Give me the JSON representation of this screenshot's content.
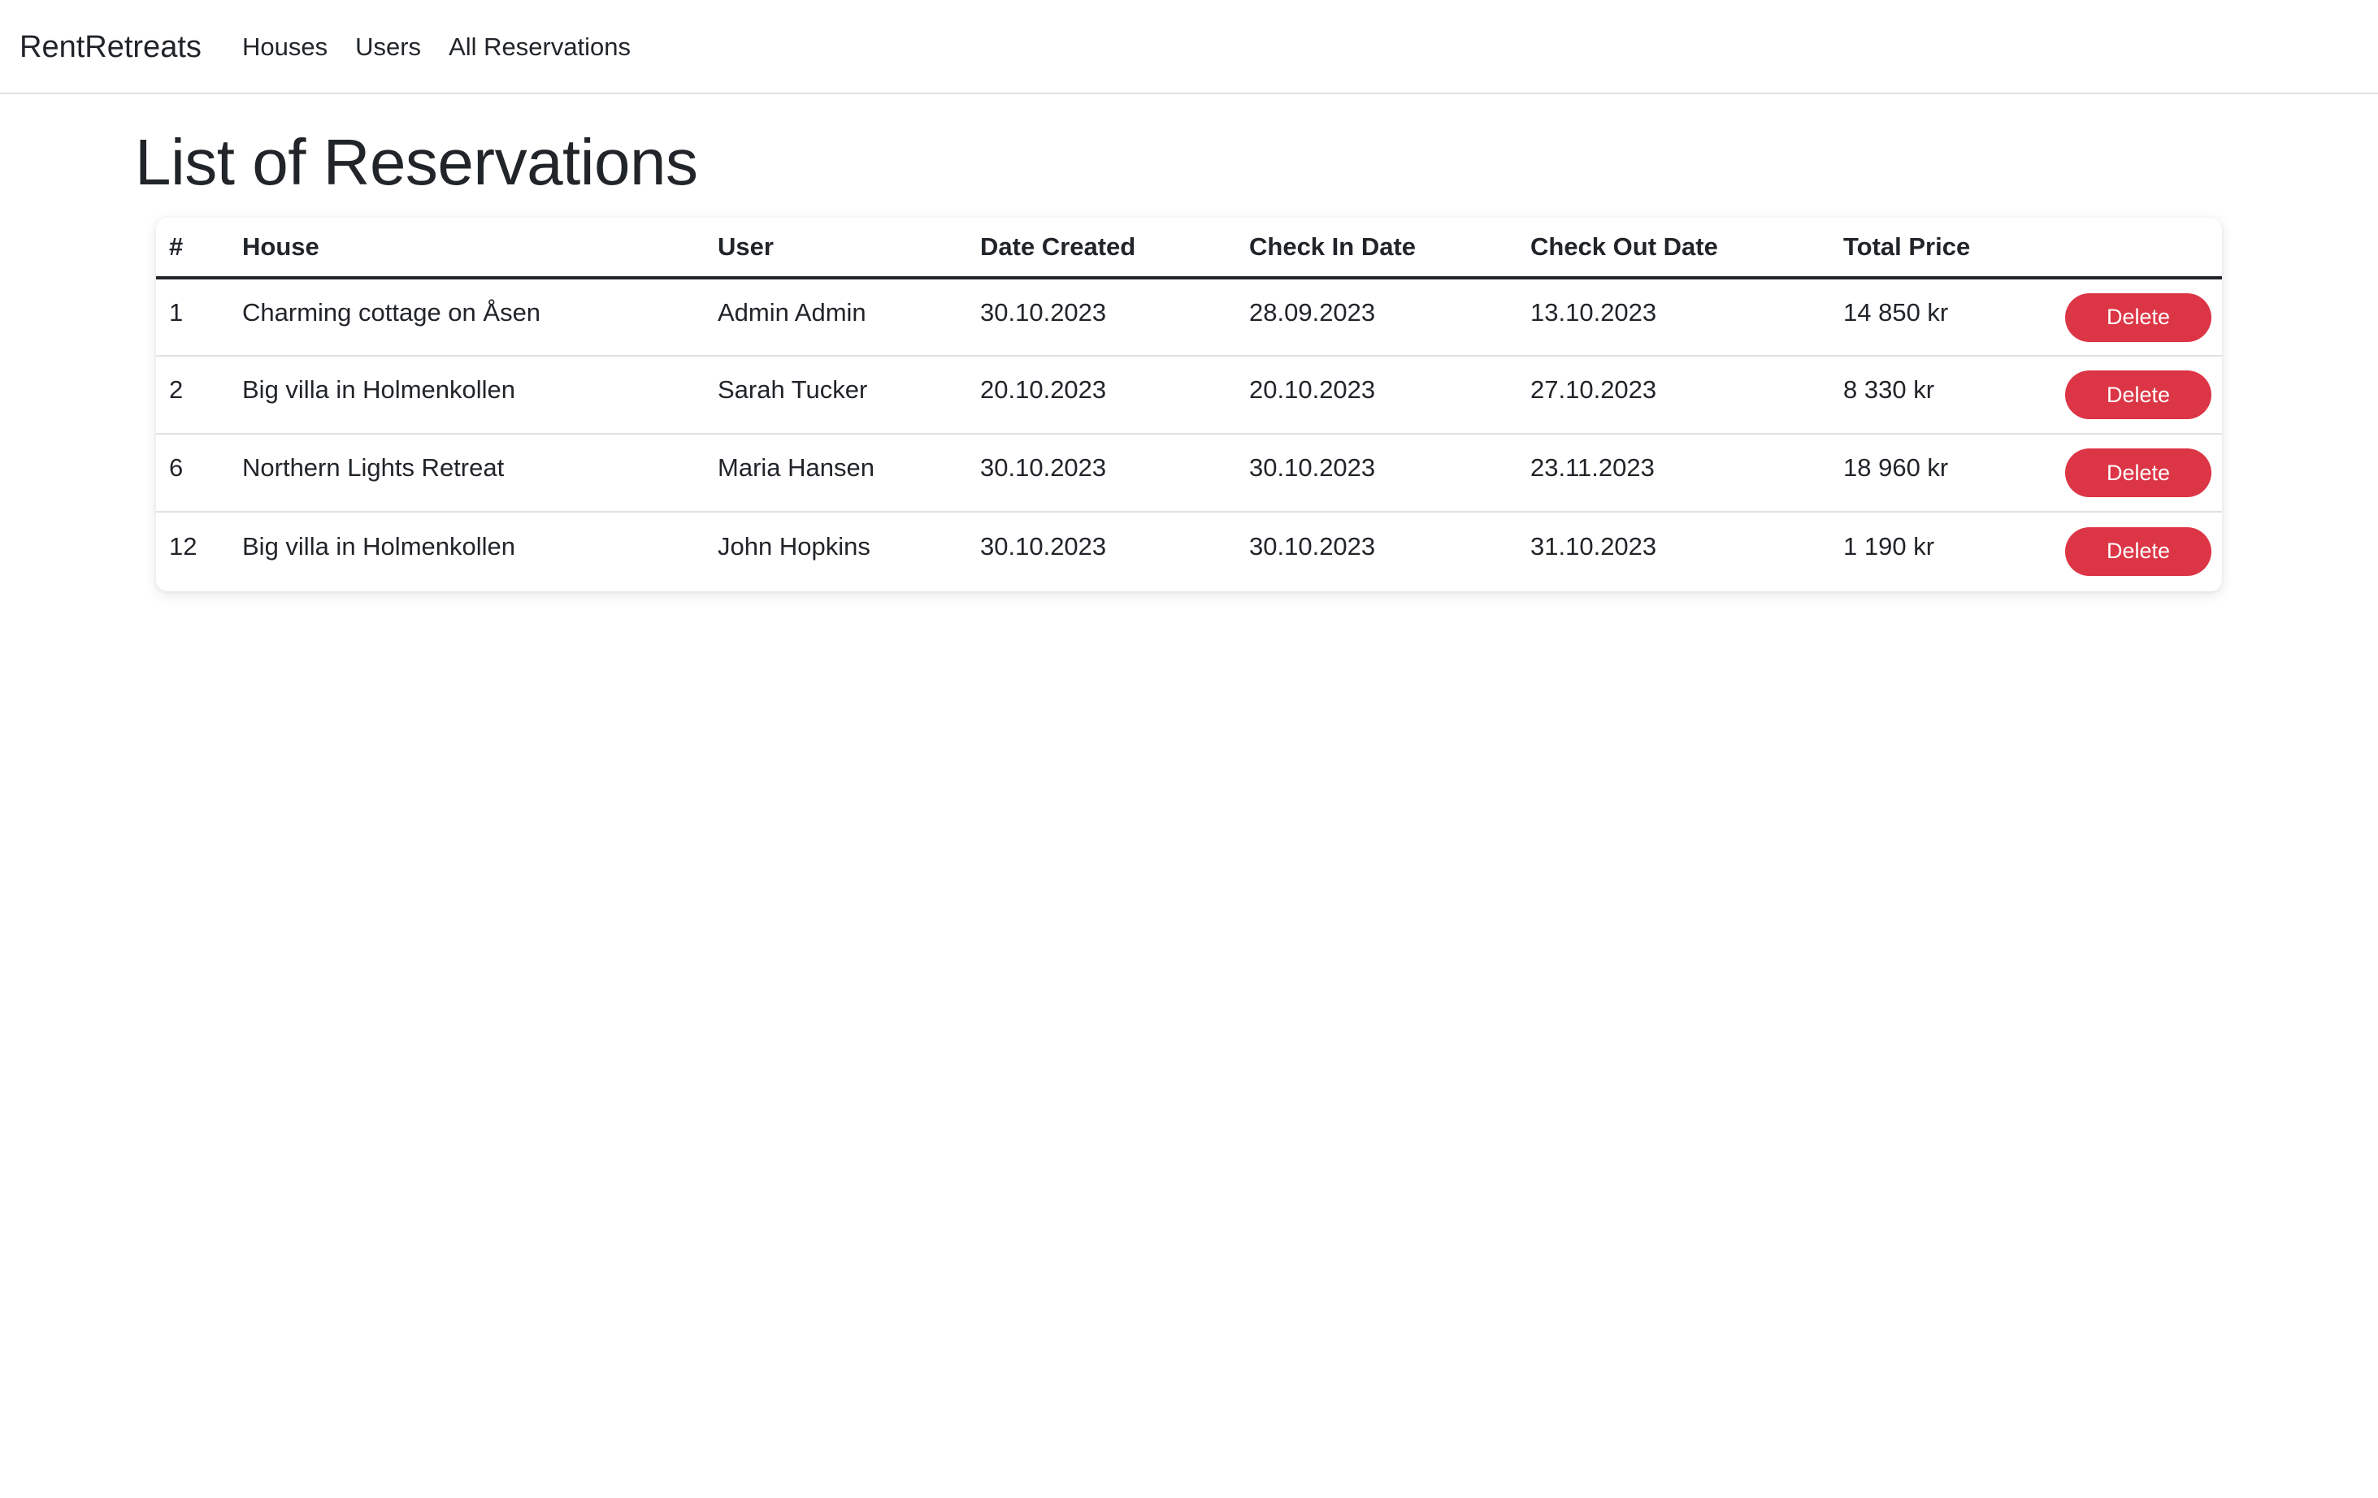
{
  "navbar": {
    "brand": "RentRetreats",
    "links": [
      "Houses",
      "Users",
      "All Reservations"
    ]
  },
  "page": {
    "title": "List of Reservations"
  },
  "table": {
    "headers": [
      "#",
      "House",
      "User",
      "Date Created",
      "Check In Date",
      "Check Out Date",
      "Total Price",
      ""
    ],
    "rows": [
      {
        "id": "1",
        "house": "Charming cottage on Åsen",
        "user": "Admin Admin",
        "created": "30.10.2023",
        "checkin": "28.09.2023",
        "checkout": "13.10.2023",
        "price": "14 850 kr"
      },
      {
        "id": "2",
        "house": "Big villa in Holmenkollen",
        "user": "Sarah Tucker",
        "created": "20.10.2023",
        "checkin": "20.10.2023",
        "checkout": "27.10.2023",
        "price": "8 330 kr"
      },
      {
        "id": "6",
        "house": "Northern Lights Retreat",
        "user": "Maria Hansen",
        "created": "30.10.2023",
        "checkin": "30.10.2023",
        "checkout": "23.11.2023",
        "price": "18 960 kr"
      },
      {
        "id": "12",
        "house": "Big villa in Holmenkollen",
        "user": "John Hopkins",
        "created": "30.10.2023",
        "checkin": "30.10.2023",
        "checkout": "31.10.2023",
        "price": "1 190 kr"
      }
    ],
    "delete_label": "Delete"
  },
  "colors": {
    "delete_button": "#dc3545",
    "text": "#212529",
    "divider": "#dee2e6"
  }
}
